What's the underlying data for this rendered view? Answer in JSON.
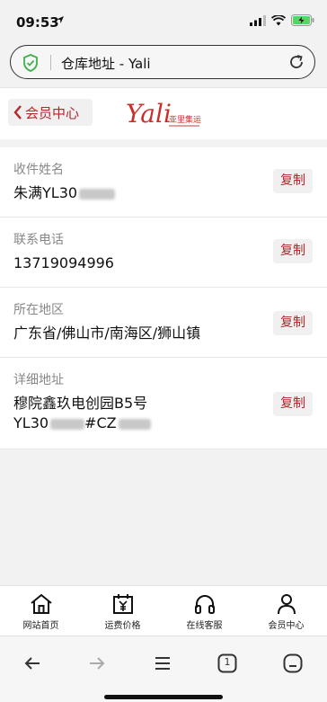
{
  "status": {
    "time": "09:53"
  },
  "browser": {
    "page_title": "仓库地址 - Yali"
  },
  "header": {
    "back_label": "会员中心",
    "logo_text": "Yali",
    "logo_cn": "亚里集运"
  },
  "fields": [
    {
      "label": "收件姓名",
      "value": "朱满YL30",
      "copy": "复制"
    },
    {
      "label": "联系电话",
      "value": "13719094996",
      "copy": "复制"
    },
    {
      "label": "所在地区",
      "value": "广东省/佛山市/南海区/狮山镇",
      "copy": "复制"
    },
    {
      "label": "详细地址",
      "value_line1": "穆院鑫玖电创园B5号",
      "value_line2": "YL30",
      "value_line2_b": "#CZ",
      "copy": "复制"
    }
  ],
  "nav": [
    {
      "label": "网站首页",
      "icon": "home-icon"
    },
    {
      "label": "运费价格",
      "icon": "calendar-yen-icon"
    },
    {
      "label": "在线客服",
      "icon": "headset-icon"
    },
    {
      "label": "会员中心",
      "icon": "person-icon"
    }
  ],
  "toolbar": {
    "tab_count": "1"
  }
}
